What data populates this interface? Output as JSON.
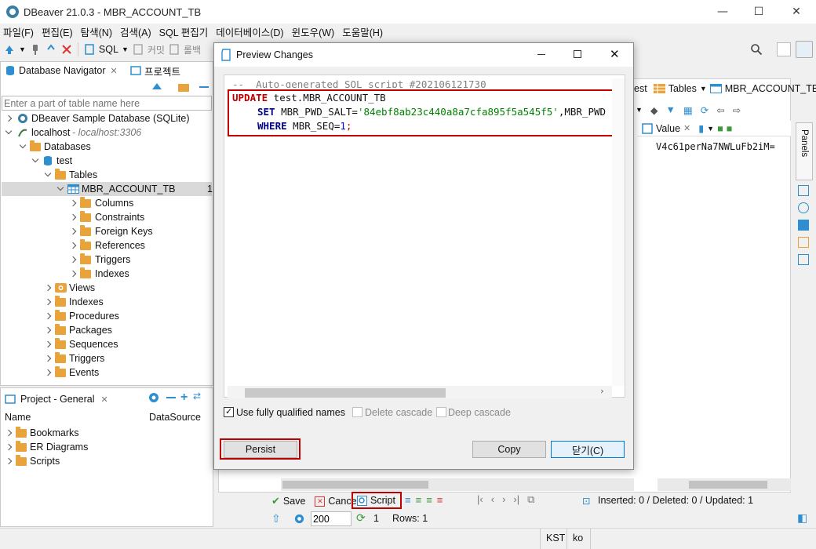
{
  "window": {
    "title": "DBeaver 21.0.3 - MBR_ACCOUNT_TB",
    "minimize": "—",
    "maximize": "☐",
    "close": "✕"
  },
  "menu": [
    "파일(F)",
    "편집(E)",
    "탐색(N)",
    "검색(A)",
    "SQL 편집기",
    "데이터베이스(D)",
    "윈도우(W)",
    "도움말(H)"
  ],
  "toolbar": {
    "sql": "SQL",
    "commit": "커밋",
    "rollback": "롤백"
  },
  "navigator": {
    "tab_label": "Database Navigator",
    "projects_tab": "프로젝트",
    "filter_placeholder": "Enter a part of table name here",
    "tree": [
      {
        "label": "DBeaver Sample Database (SQLite)"
      },
      {
        "label": "localhost",
        "sub": " - localhost:3306"
      },
      {
        "label": "Databases"
      },
      {
        "label": "test"
      },
      {
        "label": "Tables"
      },
      {
        "label": "MBR_ACCOUNT_TB",
        "badge": "1"
      },
      {
        "label": "Columns"
      },
      {
        "label": "Constraints"
      },
      {
        "label": "Foreign Keys"
      },
      {
        "label": "References"
      },
      {
        "label": "Triggers"
      },
      {
        "label": "Indexes"
      },
      {
        "label": "Views"
      },
      {
        "label": "Indexes"
      },
      {
        "label": "Procedures"
      },
      {
        "label": "Packages"
      },
      {
        "label": "Sequences"
      },
      {
        "label": "Triggers"
      },
      {
        "label": "Events"
      }
    ]
  },
  "project": {
    "tab_label": "Project - General",
    "col_name": "Name",
    "col_datasource": "DataSource",
    "items": [
      "Bookmarks",
      "ER Diagrams",
      "Scripts"
    ]
  },
  "editor": {
    "tab_partial": "est",
    "tab_tables": "Tables",
    "tab_table": "MBR_ACCOUNT_TB",
    "value_tab": "Value",
    "value_text": "V4c61perNa7NWLuFb2iM=",
    "panels_label": "Panels"
  },
  "bottom_bar": {
    "save": "Save",
    "cancel": "Cance",
    "script": "Script",
    "status": "Inserted: 0 / Deleted: 0 / Updated: 1",
    "fetch_size": "200",
    "refresh_count": "1",
    "rows": "Rows: 1"
  },
  "statusbar": {
    "timezone": "KST",
    "locale": "ko"
  },
  "dialog": {
    "title": "Preview Changes",
    "code": {
      "comment": "--  Auto-generated SQL script #202106121730",
      "update_kw": "UPDATE",
      "update_target": " test.MBR_ACCOUNT_TB",
      "set_kw": "SET",
      "set_col": " MBR_PWD_SALT=",
      "set_val": "'84ebf8ab23c440a8a7cfa895f5a545f5'",
      "set_rest": ",MBR_PWD",
      "where_kw": "WHERE",
      "where_col": " MBR_SEQ=",
      "where_val": "1",
      "semicolon": ";"
    },
    "opt_qualified": "Use fully qualified names",
    "opt_delete_cascade": "Delete cascade",
    "opt_deep_cascade": "Deep cascade",
    "btn_persist": "Persist",
    "btn_copy": "Copy",
    "btn_close": "닫기(C)"
  },
  "colors": {
    "highlight_red": "#c00000",
    "folder": "#e8a33a",
    "accent_blue": "#1e6bb8"
  }
}
